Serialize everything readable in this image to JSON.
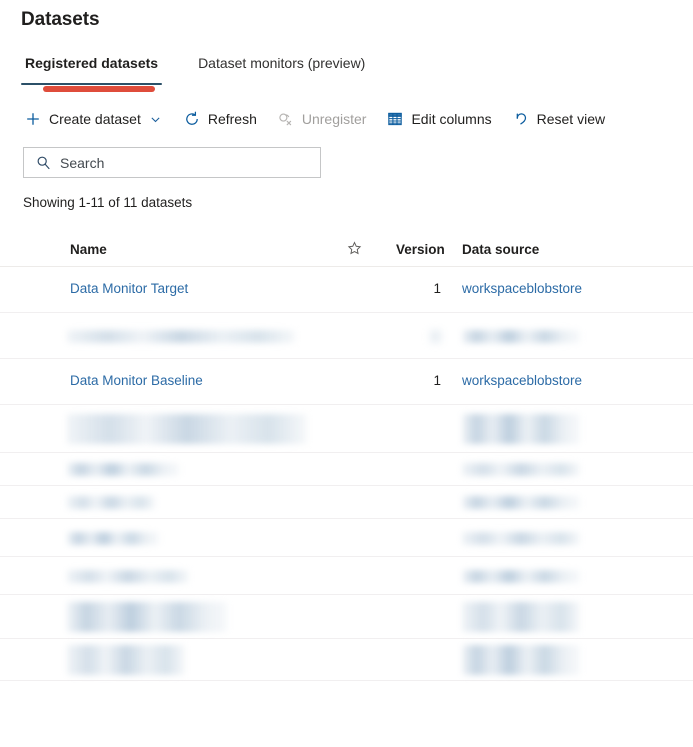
{
  "page": {
    "title": "Datasets"
  },
  "tabs": [
    {
      "label": "Registered datasets",
      "active": true
    },
    {
      "label": "Dataset monitors (preview)",
      "active": false
    }
  ],
  "toolbar": {
    "items": [
      {
        "label": "Create dataset",
        "icon": "plus-icon",
        "disabled": false,
        "has_chevron": true
      },
      {
        "label": "Refresh",
        "icon": "refresh-icon",
        "disabled": false,
        "has_chevron": false
      },
      {
        "label": "Unregister",
        "icon": "unregister-icon",
        "disabled": true,
        "has_chevron": false
      },
      {
        "label": "Edit columns",
        "icon": "table-columns-icon",
        "disabled": false,
        "has_chevron": false
      },
      {
        "label": "Reset view",
        "icon": "undo-icon",
        "disabled": false,
        "has_chevron": false
      }
    ]
  },
  "search": {
    "placeholder": "Search",
    "value": "",
    "icon": "search-icon"
  },
  "status": {
    "showing": "Showing 1-11 of 11 datasets"
  },
  "table": {
    "columns": [
      {
        "key": "name",
        "label": "Name"
      },
      {
        "key": "favorite",
        "label": "",
        "icon": "star-icon"
      },
      {
        "key": "version",
        "label": "Version"
      },
      {
        "key": "source",
        "label": "Data source"
      }
    ],
    "rows": [
      {
        "name": "Data Monitor Target",
        "version": "1",
        "source": "workspaceblobstore",
        "redacted": false
      },
      {
        "name": "",
        "version": "",
        "source": "",
        "redacted": true
      },
      {
        "name": "Data Monitor Baseline",
        "version": "1",
        "source": "workspaceblobstore",
        "redacted": false
      },
      {
        "name": "",
        "version": "",
        "source": "",
        "redacted": true
      },
      {
        "name": "",
        "version": "",
        "source": "",
        "redacted": true
      },
      {
        "name": "",
        "version": "",
        "source": "",
        "redacted": true
      },
      {
        "name": "",
        "version": "",
        "source": "",
        "redacted": true
      },
      {
        "name": "",
        "version": "",
        "source": "",
        "redacted": true
      },
      {
        "name": "",
        "version": "",
        "source": "",
        "redacted": true
      },
      {
        "name": "",
        "version": "",
        "source": "",
        "redacted": true
      }
    ]
  },
  "colors": {
    "link": "#2c6ba6",
    "tab_underline": "#2b5068",
    "annotation": "#df4c3b",
    "icon_blue": "#0b5c9e",
    "disabled": "#a19f9d"
  }
}
